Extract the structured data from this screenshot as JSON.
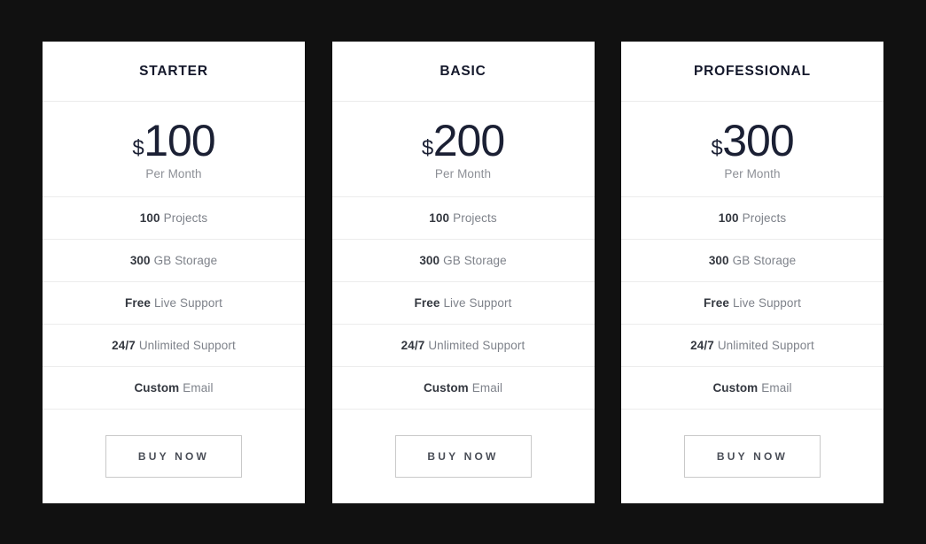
{
  "page": {
    "background_color": "#111111",
    "card_background": "#ffffff",
    "divider_color": "#ececec",
    "title_color": "#14182b",
    "price_color": "#1b2034",
    "muted_color": "#7e828a",
    "button_border_color": "#c9c9c9"
  },
  "plans": [
    {
      "title": "STARTER",
      "currency": "$",
      "amount": "100",
      "period": "Per Month",
      "features": [
        {
          "strong": "100",
          "rest": "Projects"
        },
        {
          "strong": "300",
          "rest": "GB Storage"
        },
        {
          "strong": "Free",
          "rest": "Live Support"
        },
        {
          "strong": "24/7",
          "rest": "Unlimited Support"
        },
        {
          "strong": "Custom",
          "rest": "Email"
        }
      ],
      "cta_label": "BUY NOW"
    },
    {
      "title": "BASIC",
      "currency": "$",
      "amount": "200",
      "period": "Per Month",
      "features": [
        {
          "strong": "100",
          "rest": "Projects"
        },
        {
          "strong": "300",
          "rest": "GB Storage"
        },
        {
          "strong": "Free",
          "rest": "Live Support"
        },
        {
          "strong": "24/7",
          "rest": "Unlimited Support"
        },
        {
          "strong": "Custom",
          "rest": "Email"
        }
      ],
      "cta_label": "BUY NOW"
    },
    {
      "title": "PROFESSIONAL",
      "currency": "$",
      "amount": "300",
      "period": "Per Month",
      "features": [
        {
          "strong": "100",
          "rest": "Projects"
        },
        {
          "strong": "300",
          "rest": "GB Storage"
        },
        {
          "strong": "Free",
          "rest": "Live Support"
        },
        {
          "strong": "24/7",
          "rest": "Unlimited Support"
        },
        {
          "strong": "Custom",
          "rest": "Email"
        }
      ],
      "cta_label": "BUY NOW"
    }
  ]
}
